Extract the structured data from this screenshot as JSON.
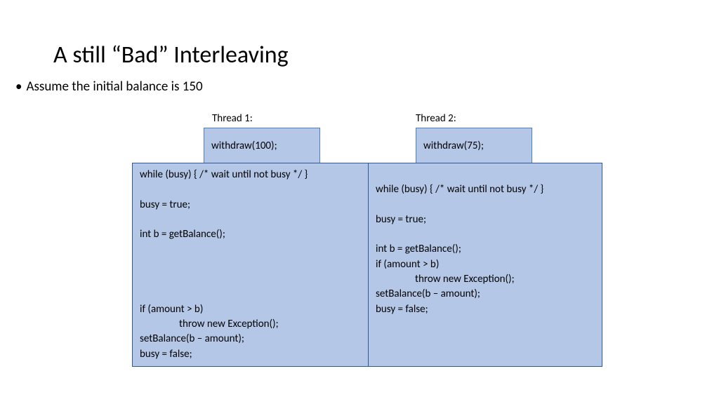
{
  "title": "A still “Bad” Interleaving",
  "assumption": "Assume the initial balance is 150",
  "thread1_label": "Thread 1:",
  "thread2_label": "Thread 2:",
  "thread1_call": "withdraw(100);",
  "thread2_call": "withdraw(75);",
  "code_left_line1": "while (busy) { /* wait until not busy */ }",
  "code_left_line2": "busy = true;",
  "code_left_line3": "int b = getBalance();",
  "code_left_line4": "if (amount > b)",
  "code_left_line5": "throw new Exception();",
  "code_left_line6": "setBalance(b – amount);",
  "code_left_line7": "busy = false;",
  "code_right_line1": "while (busy) { /* wait until not busy */ }",
  "code_right_line2": "busy = true;",
  "code_right_line3": "int b = getBalance();",
  "code_right_line4": "if (amount > b)",
  "code_right_line5": "throw new Exception();",
  "code_right_line6": "setBalance(b – amount);",
  "code_right_line7": "busy = false;"
}
